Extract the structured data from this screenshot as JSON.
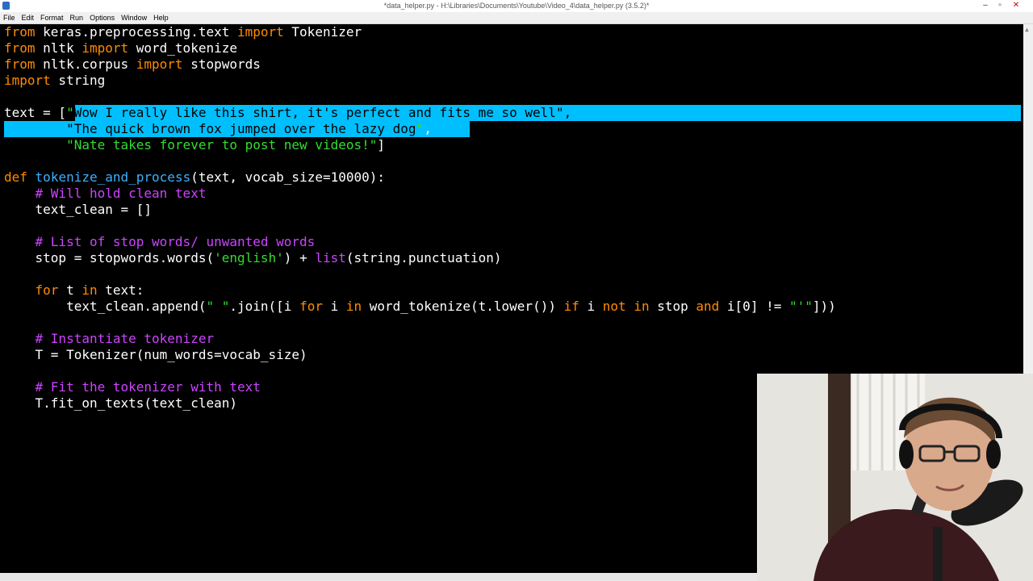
{
  "window": {
    "title": "*data_helper.py - H:\\Libraries\\Documents\\Youtube\\Video_4\\data_helper.py (3.5.2)*"
  },
  "menu": [
    "File",
    "Edit",
    "Format",
    "Run",
    "Options",
    "Window",
    "Help"
  ],
  "code": {
    "l1": [
      "from",
      " keras.preprocessing.text ",
      "import",
      " Tokenizer"
    ],
    "l2": [
      "from",
      " nltk ",
      "import",
      " word_tokenize"
    ],
    "l3": [
      "from",
      " nltk.corpus ",
      "import",
      " stopwords"
    ],
    "l4": [
      "import",
      " string"
    ],
    "l6": [
      "text = [",
      "\"",
      "Wow I really like this shirt, it's perfect and fits me so well\","
    ],
    "l7": [
      "        ",
      "\"The quick brown fox jumped over the lazy dog",
      "\"",
      ","
    ],
    "l8": [
      "        ",
      "\"Nate takes forever to post new videos!\"",
      "]"
    ],
    "l10": [
      "def",
      " ",
      "tokenize_and_process",
      "(text, vocab_size=10000):"
    ],
    "l11": [
      "    ",
      "# Will hold clean text"
    ],
    "l12": [
      "    text_clean = []"
    ],
    "l14": [
      "    ",
      "# List of stop words/ unwanted words"
    ],
    "l15": [
      "    stop = stopwords.words(",
      "'english'",
      ") + ",
      "list",
      "(string.punctuation)"
    ],
    "l17": [
      "    ",
      "for",
      " t ",
      "in",
      " text:"
    ],
    "l18": [
      "        text_clean.append(",
      "\" \"",
      ".join([i ",
      "for",
      " i ",
      "in",
      " word_tokenize(t.lower()) ",
      "if",
      " i ",
      "not",
      " ",
      "in",
      " stop ",
      "and",
      " i[0] != ",
      "\"'\"",
      "]))"
    ],
    "l20": [
      "    ",
      "# Instantiate tokenizer"
    ],
    "l21": [
      "    T = Tokenizer(num_words=vocab_size)"
    ],
    "l23": [
      "    ",
      "# Fit the tokenizer with text"
    ],
    "l24": [
      "    T.fit_on_texts(text_clean)"
    ]
  },
  "colors": {
    "keyword": "#ff8c00",
    "definition": "#3cb0ff",
    "string": "#33dd33",
    "comment": "#cc44ff",
    "selection": "#00bfff"
  }
}
